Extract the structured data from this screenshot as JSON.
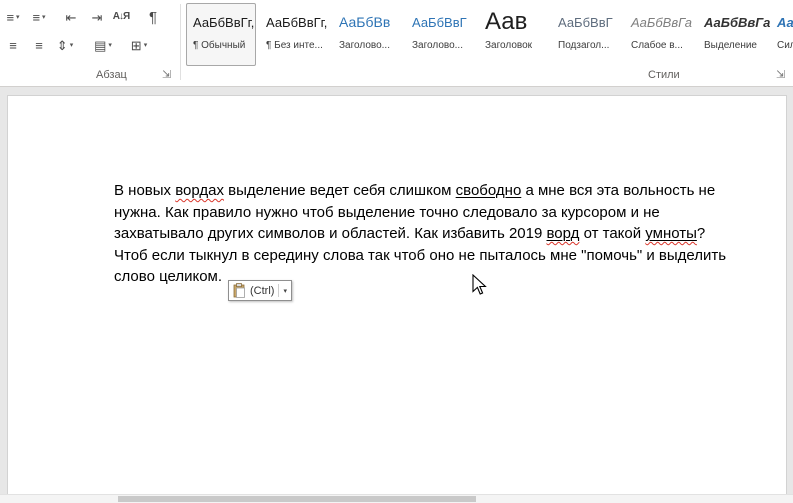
{
  "ribbon": {
    "paragraph_group": {
      "label": "Абзац",
      "icons": {
        "bullets": "≡",
        "numbering": "≡",
        "indent_decrease": "⇤",
        "indent_increase": "⇥",
        "sort": "А↓Я",
        "pilcrow": "¶",
        "align_left": "≡",
        "align_justify": "≡",
        "line_spacing": "⇕",
        "shading": "▤",
        "borders": "⊞",
        "dropdown": "▾",
        "dialog_launcher": "⇲"
      }
    },
    "styles_group": {
      "label": "Стили",
      "dialog_launcher": "⇲",
      "styles": [
        {
          "preview": "АаБбВвГг,",
          "name": "¶ Обычный"
        },
        {
          "preview": "АаБбВвГг,",
          "name": "¶ Без инте..."
        },
        {
          "preview": "АаБбВв",
          "name": "Заголово..."
        },
        {
          "preview": "АаБбВвГ",
          "name": "Заголово..."
        },
        {
          "preview": "Аав",
          "name": "Заголовок"
        },
        {
          "preview": "АаБбВвГ",
          "name": "Подзагол..."
        },
        {
          "preview": "АаБбВвГа",
          "name": "Слабое в..."
        },
        {
          "preview": "АаБбВвГа",
          "name": "Выделение"
        },
        {
          "preview": "АаБбВвГ",
          "name": "Сильное..."
        }
      ]
    }
  },
  "document": {
    "paragraph_lines": [
      {
        "segments": [
          {
            "text": "В новых "
          },
          {
            "text": "вордах"
          },
          {
            "text": " выделение ведет себя слишком "
          },
          {
            "text": "свободно"
          },
          {
            "text": " а мне вся эта вольность не"
          }
        ]
      },
      {
        "segments": [
          {
            "text": "нужна. Как правило нужно чтоб выделение точно следовало за курсором и не"
          }
        ]
      },
      {
        "segments": [
          {
            "text": "захватывало других символов и областей. Как избавить 2019 "
          },
          {
            "text": "ворд"
          },
          {
            "text": " от такой "
          },
          {
            "text": "умноты"
          },
          {
            "text": "?"
          }
        ]
      },
      {
        "segments": [
          {
            "text": "Чтоб если тыкнул в середину слова так чтоб оно не пыталось мне \"помочь\" и выделить"
          }
        ]
      },
      {
        "segments": [
          {
            "text": "слово целиком."
          }
        ]
      }
    ],
    "paste_options": {
      "label": "(Ctrl)",
      "dropdown": "▾"
    }
  },
  "colors": {
    "heading_blue": "#2e74b5",
    "spellcheck_red": "#d9352a",
    "canvas_bg": "#e7e7e7"
  }
}
